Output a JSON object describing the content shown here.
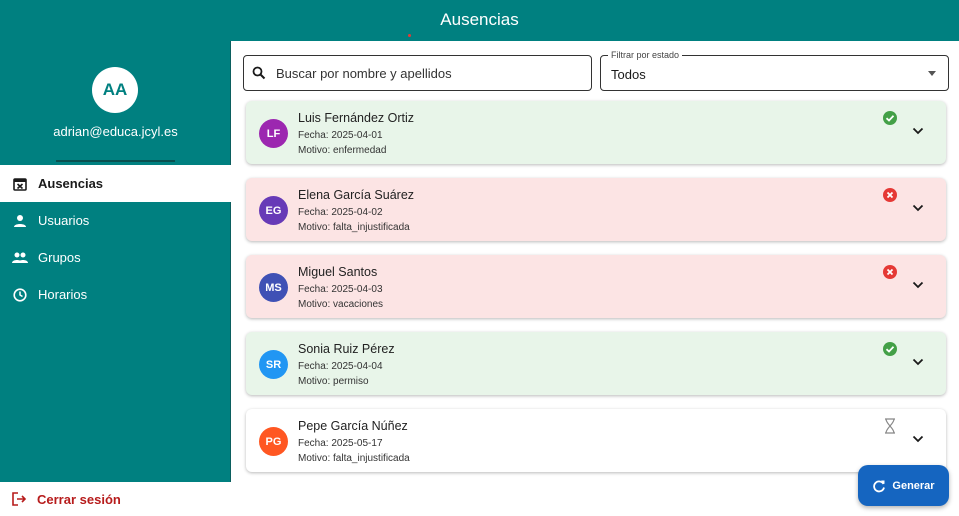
{
  "appbar": {
    "title": "Ausencias"
  },
  "drawer": {
    "avatar_initials": "AA",
    "email": "adrian@educa.jcyl.es",
    "nav": [
      {
        "label": "Ausencias",
        "icon": "calendar-x-icon",
        "active": true
      },
      {
        "label": "Usuarios",
        "icon": "person-icon",
        "active": false
      },
      {
        "label": "Grupos",
        "icon": "group-icon",
        "active": false
      },
      {
        "label": "Horarios",
        "icon": "clock-icon",
        "active": false
      }
    ],
    "logout_label": "Cerrar sesión"
  },
  "search": {
    "placeholder": "Buscar por nombre y apellidos",
    "value": ""
  },
  "filter": {
    "label": "Filtrar por estado",
    "value": "Todos"
  },
  "absences": [
    {
      "initials": "LF",
      "avatar_color": "#9c27b0",
      "name": "Luis Fernández Ortiz",
      "fecha": "Fecha: 2025-04-01",
      "motivo": "Motivo: enfermedad",
      "status": "approved",
      "status_icon": "check-circle-icon",
      "bg": "#e8f5e9"
    },
    {
      "initials": "EG",
      "avatar_color": "#673ab7",
      "name": "Elena García Suárez",
      "fecha": "Fecha: 2025-04-02",
      "motivo": "Motivo: falta_injustificada",
      "status": "rejected",
      "status_icon": "x-circle-icon",
      "bg": "#fce4e4"
    },
    {
      "initials": "MS",
      "avatar_color": "#3f51b5",
      "name": "Miguel Santos",
      "fecha": "Fecha: 2025-04-03",
      "motivo": "Motivo: vacaciones",
      "status": "rejected",
      "status_icon": "x-circle-icon",
      "bg": "#fce4e4"
    },
    {
      "initials": "SR",
      "avatar_color": "#2196f3",
      "name": "Sonia Ruiz Pérez",
      "fecha": "Fecha: 2025-04-04",
      "motivo": "Motivo: permiso",
      "status": "approved",
      "status_icon": "check-circle-icon",
      "bg": "#e8f5e9"
    },
    {
      "initials": "PG",
      "avatar_color": "#ff5722",
      "name": "Pepe García Núñez",
      "fecha": "Fecha: 2025-05-17",
      "motivo": "Motivo: falta_injustificada",
      "status": "pending",
      "status_icon": "hourglass-icon",
      "bg": "#ffffff"
    }
  ],
  "fab": {
    "label": "Generar",
    "icon": "refresh-icon"
  },
  "colors": {
    "primary": "#008080",
    "approved": "#43a047",
    "rejected": "#e53935",
    "fab": "#1565c0",
    "logout": "#b71c1c"
  }
}
